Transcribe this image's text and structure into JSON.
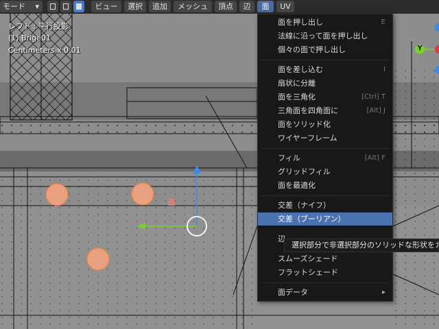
{
  "header": {
    "mode_label": "モード",
    "menus": [
      "ビュー",
      "選択",
      "追加",
      "メッシュ",
      "頂点",
      "辺",
      "面",
      "UV"
    ],
    "active_menu": "面"
  },
  "overlay": {
    "view_name": "レフト : 平行投影",
    "object_name": "(1) Brige01",
    "grid_scale": "Centimeters x 0.01"
  },
  "gizmo": {
    "y_axis_label": "Y"
  },
  "face_menu": {
    "groups": [
      [
        {
          "label": "面を押し出し",
          "shortcut": "E"
        },
        {
          "label": "法線に沿って面を押し出し",
          "shortcut": ""
        },
        {
          "label": "個々の面で押し出し",
          "shortcut": ""
        }
      ],
      [
        {
          "label": "面を差し込む",
          "shortcut": "I"
        },
        {
          "label": "扇状に分離",
          "shortcut": ""
        },
        {
          "label": "面を三角化",
          "shortcut": "[Ctrl] T"
        },
        {
          "label": "三角面を四角面に",
          "shortcut": "[Alt] J"
        },
        {
          "label": "面をソリッド化",
          "shortcut": ""
        },
        {
          "label": "ワイヤーフレーム",
          "shortcut": ""
        }
      ],
      [
        {
          "label": "フィル",
          "shortcut": "[Alt] F"
        },
        {
          "label": "グリッドフィル",
          "shortcut": ""
        },
        {
          "label": "面を最適化",
          "shortcut": ""
        }
      ],
      [
        {
          "label": "交差（ナイフ）",
          "shortcut": ""
        },
        {
          "label": "交差（ブーリアン）",
          "shortcut": ""
        },
        {
          "label": "辺",
          "shortcut": ""
        },
        {
          "label": "スムーズシェード",
          "shortcut": ""
        },
        {
          "label": "フラットシェード",
          "shortcut": ""
        }
      ],
      [
        {
          "label": "面データ",
          "shortcut": ""
        }
      ]
    ],
    "highlighted": "交差（ブーリアン）"
  },
  "tooltip": {
    "text": "選択部分で非選択部分のソリッドな形状をカ"
  },
  "colors": {
    "header_bg": "#2b2b2b",
    "menu_bg": "#181818",
    "highlight": "#4a72b0",
    "vertex_selected": "#f08020",
    "gizmo_y": "#7bd026",
    "gizmo_x": "#e0384a",
    "gizmo_z": "#3c8ce7"
  }
}
